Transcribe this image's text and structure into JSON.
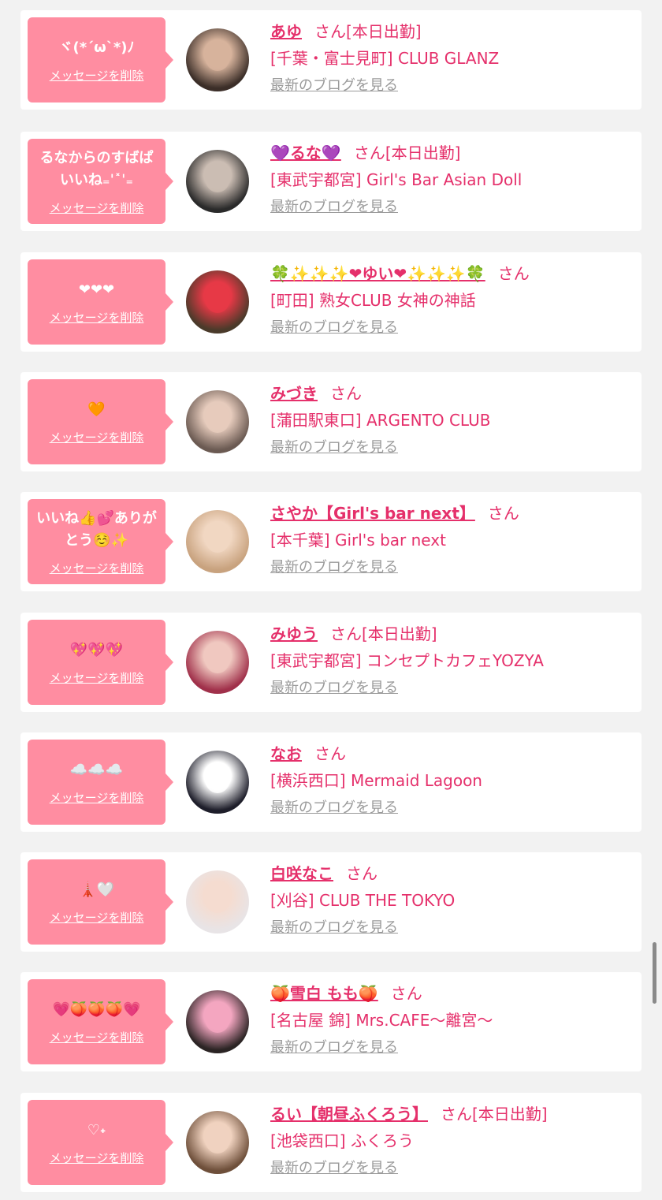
{
  "delete_label": "メッセージを削除",
  "blog_label": "最新のブログを見る",
  "san_label": "さん",
  "cards": [
    {
      "message": "ヾ(*´ω`*)ﾉ",
      "name": "あゆ",
      "status": "[本日出勤]",
      "shop": "[千葉・富士見町] CLUB GLANZ",
      "avatar_colors": [
        "#3b2e28",
        "#d7b39c"
      ]
    },
    {
      "message": "るなからのすばぱいいね₌ˈ˟ˈ₌",
      "name": "💜るな💜",
      "status": "[本日出勤]",
      "shop": "[東武宇都宮] Girl's Bar Asian Doll",
      "avatar_colors": [
        "#2a2a2a",
        "#cbbdb3"
      ]
    },
    {
      "message": "❤❤❤",
      "name": "🍀✨✨✨❤ゆい❤✨✨✨🍀",
      "status": "",
      "shop": "[町田] 熟女CLUB 女神の神話",
      "avatar_colors": [
        "#4a3a2a",
        "#e63946"
      ]
    },
    {
      "message": "🧡",
      "name": "みづき",
      "status": "",
      "shop": "[蒲田駅東口] ARGENTO CLUB",
      "avatar_colors": [
        "#6b5a52",
        "#e6cbbc"
      ]
    },
    {
      "message": "いいね👍💕ありがとう☺️✨",
      "name": "さやか【Girl's bar next】",
      "status": "",
      "shop": "[本千葉] Girl's bar next",
      "avatar_colors": [
        "#c8a27e",
        "#f1d7c2"
      ]
    },
    {
      "message": "💖💖💖",
      "name": "みゆう",
      "status": "[本日出勤]",
      "shop": "[東武宇都宮] コンセプトカフェYOZYA",
      "avatar_colors": [
        "#a0304a",
        "#f0c8c0"
      ]
    },
    {
      "message": "☁️☁️☁️",
      "name": "なお",
      "status": "",
      "shop": "[横浜西口] Mermaid Lagoon",
      "avatar_colors": [
        "#1e1e2a",
        "#ffffff"
      ]
    },
    {
      "message": "🗼🤍",
      "name": "白咲なこ",
      "status": "",
      "shop": "[刈谷] CLUB THE TOKYO",
      "avatar_colors": [
        "#e8e4e6",
        "#f5dcd0"
      ]
    },
    {
      "message": "💗🍑🍑🍑💗",
      "name": "🍑雪白 もも🍑",
      "status": "",
      "shop": "[名古屋 錦] Mrs.CAFE〜離宮〜",
      "avatar_colors": [
        "#2b2424",
        "#f3a6c0"
      ]
    },
    {
      "message": "♡˖",
      "name": "るい【朝昼ふくろう】",
      "status": "[本日出勤]",
      "shop": "[池袋西口] ふくろう",
      "avatar_colors": [
        "#6e4f3a",
        "#f0d2bf"
      ]
    }
  ]
}
